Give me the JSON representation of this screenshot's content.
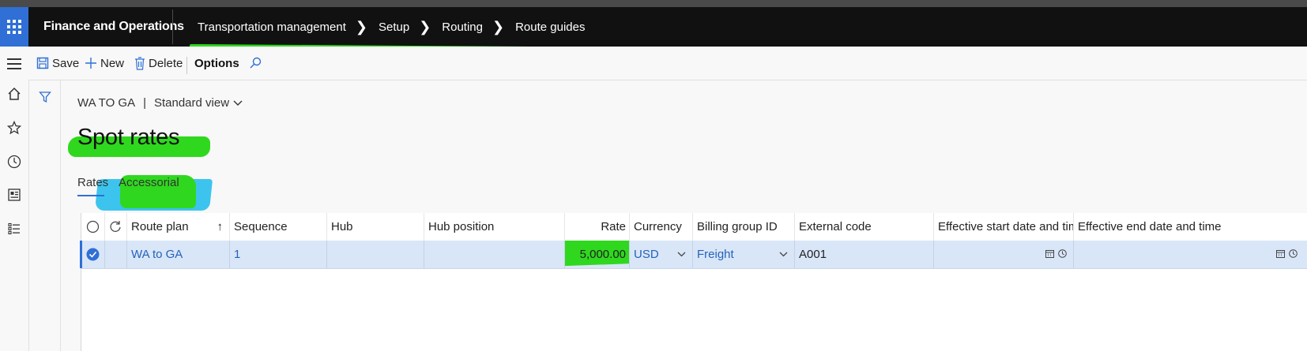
{
  "app": {
    "name": "Finance and Operations"
  },
  "breadcrumb": [
    "Transportation management",
    "Setup",
    "Routing",
    "Route guides"
  ],
  "toolbar": {
    "save": "Save",
    "new": "New",
    "delete": "Delete",
    "options": "Options"
  },
  "record": {
    "name": "WA TO GA",
    "separator": "|",
    "view": "Standard view"
  },
  "page": {
    "title": "Spot rates"
  },
  "tabs": [
    "Rates",
    "Accessorial"
  ],
  "grid": {
    "columns": [
      "Route plan",
      "Sequence",
      "Hub",
      "Hub position",
      "Rate",
      "Currency",
      "Billing group ID",
      "External code",
      "Effective start date and time",
      "Effective end date and time"
    ],
    "rows": [
      {
        "route_plan": "WA to GA",
        "sequence": "1",
        "hub": "",
        "hub_position": "",
        "rate": "5,000.00",
        "currency": "USD",
        "billing_group_id": "Freight",
        "external_code": "A001",
        "start": "",
        "end": ""
      }
    ]
  },
  "colors": {
    "accent": "#2f6fd6",
    "highlight_green": "#2fd81e",
    "highlight_blue": "#3cc4ee",
    "nav_bg": "#111111"
  }
}
